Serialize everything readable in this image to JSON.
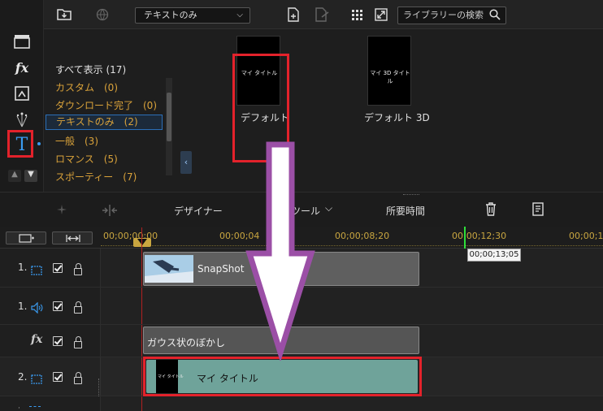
{
  "library": {
    "dropdown_value": "テキストのみ",
    "search_placeholder": "ライブラリーの検索",
    "categories": [
      {
        "label": "すべて表示 (17)",
        "color": "#e0e0e0"
      },
      {
        "label": "カスタム　(0)",
        "color": "#d9a23a"
      },
      {
        "label": "ダウンロード完了　(0)",
        "color": "#d9a23a"
      },
      {
        "label": "テキストのみ　(2)",
        "color": "#d9a23a"
      },
      {
        "label": "一般　(3)",
        "color": "#d9a23a"
      },
      {
        "label": "ロマンス　(5)",
        "color": "#d9a23a"
      },
      {
        "label": "スポーティー　(7)",
        "color": "#d9a23a"
      }
    ],
    "templates": [
      {
        "thumb_text": "マイ タイトル",
        "label": "デフォルト"
      },
      {
        "thumb_text": "マイ 3D タイトル",
        "label": "デフォルト 3D"
      }
    ]
  },
  "timeline_toolbar": {
    "designer": "デザイナー",
    "tools": "ツール",
    "duration": "所要時間"
  },
  "ruler": {
    "ticks": [
      "00;00;00;00",
      "00;00;04",
      "00;00;08;20",
      "00;00;12;30",
      "00;00;1"
    ],
    "tooltip": "00;00;13;05"
  },
  "tracks": [
    {
      "label": "1.",
      "kind": "video"
    },
    {
      "label": "1.",
      "kind": "audio"
    },
    {
      "label": "fx",
      "kind": "effect"
    },
    {
      "label": "2.",
      "kind": "video"
    }
  ],
  "clips": {
    "snapshot": "SnapShot",
    "effect": "ガウス状のぼかし",
    "title_thumb": "マイ タイトル",
    "title": "マイ タイトル"
  },
  "colors": {
    "highlight": "#e3222b",
    "arrow": "#9b4fa6",
    "accent": "#d9a23a",
    "title_clip": "#6fa39a"
  }
}
